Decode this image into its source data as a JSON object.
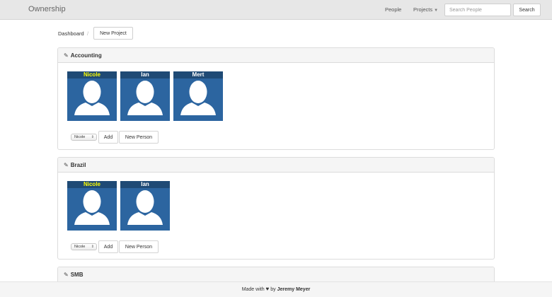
{
  "navbar": {
    "brand": "Ownership",
    "people_link": "People",
    "projects_link": "Projects",
    "search_placeholder": "Search People",
    "search_button": "Search"
  },
  "breadcrumb": {
    "dashboard": "Dashboard",
    "separator": "/"
  },
  "new_project_button": "New Project",
  "projects": [
    {
      "name": "Accounting",
      "members": [
        {
          "name": "Nicole",
          "highlight": true
        },
        {
          "name": "Ian",
          "highlight": false
        },
        {
          "name": "Mert",
          "highlight": false
        }
      ],
      "select_value": "Nicole",
      "add_button": "Add",
      "new_person_button": "New Person"
    },
    {
      "name": "Brazil",
      "members": [
        {
          "name": "Nicole",
          "highlight": true
        },
        {
          "name": "Ian",
          "highlight": false
        }
      ],
      "select_value": "Nicole",
      "add_button": "Add",
      "new_person_button": "New Person"
    },
    {
      "name": "SMB"
    }
  ],
  "footer": {
    "made_with": "Made with",
    "by": "by",
    "author": "Jeremy Meyer"
  },
  "colors": {
    "card_bg": "#2c65a0",
    "card_header": "#1f4a75",
    "highlight_name": "#ffff00"
  }
}
